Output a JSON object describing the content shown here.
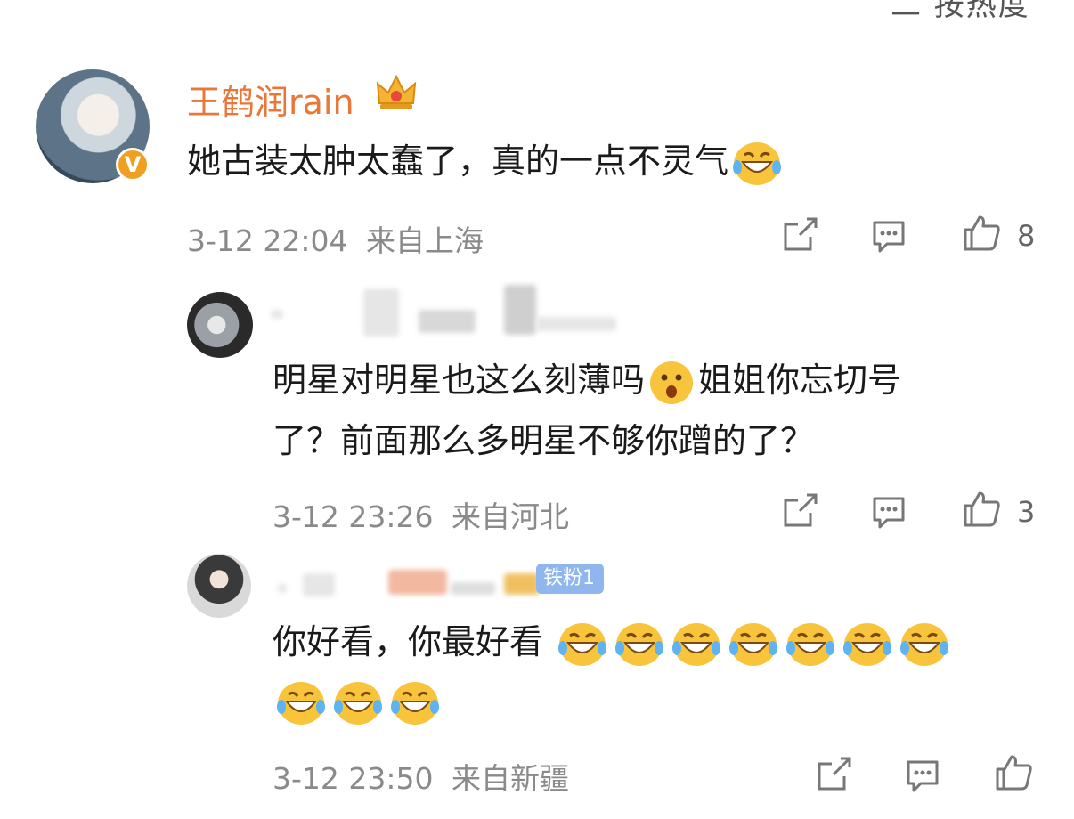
{
  "header": {
    "sort_label": "二 按热度"
  },
  "main_comment": {
    "username": "王鹤润rain",
    "text": "她古装太肿太蠢了，真的一点不灵气",
    "time": "3-12 22:04",
    "location": "来自上海",
    "likes": "8",
    "verified_badge": "V",
    "icons": [
      "crown-icon",
      "laugh-emoji",
      "share-icon",
      "comment-icon",
      "like-icon"
    ]
  },
  "replies": [
    {
      "text_line1": "明星对明星也这么刻薄吗",
      "text_line1b": "姐姐你忘切号",
      "text_line2": "了？前面那么多明星不够你蹭的了？",
      "time": "3-12 23:26",
      "location": "来自河北",
      "likes": "3"
    },
    {
      "badge": "铁粉1",
      "text": "你好看，你最好看",
      "time": "3-12 23:50",
      "location": "来自新疆",
      "likes": ""
    }
  ],
  "colors": {
    "username": "#e8773a",
    "meta": "#8a8a8a",
    "badge": "#8fb7ee",
    "vip": "#f0a020"
  }
}
